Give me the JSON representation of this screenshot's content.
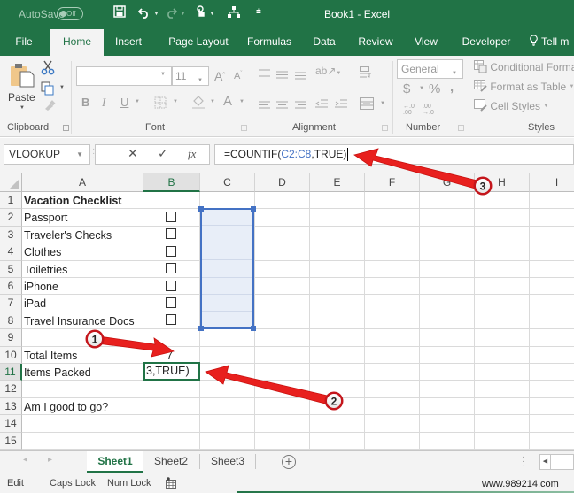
{
  "titlebar": {
    "autosave_label": "AutoSave",
    "autosave_state": "Off",
    "title": "Book1  -  Excel",
    "quick_access": [
      "save-icon",
      "undo-icon",
      "redo-icon",
      "touch-mode-icon",
      "org-chart-icon",
      "customize-qat-icon"
    ]
  },
  "ribbon_tabs": [
    {
      "label": "File",
      "active": false
    },
    {
      "label": "Home",
      "active": true
    },
    {
      "label": "Insert",
      "active": false
    },
    {
      "label": "Page Layout",
      "active": false
    },
    {
      "label": "Formulas",
      "active": false
    },
    {
      "label": "Data",
      "active": false
    },
    {
      "label": "Review",
      "active": false
    },
    {
      "label": "View",
      "active": false
    },
    {
      "label": "Developer",
      "active": false
    },
    {
      "label": "Tell m",
      "active": false
    }
  ],
  "ribbon": {
    "clipboard": {
      "label": "Clipboard",
      "paste_label": "Paste"
    },
    "font": {
      "label": "Font",
      "font_name": "",
      "font_size": "11",
      "bold": "B",
      "italic": "I",
      "underline": "U",
      "font_color": "A"
    },
    "alignment": {
      "label": "Alignment"
    },
    "number": {
      "label": "Number",
      "format": "General",
      "currency": "$",
      "percent": "%",
      "comma": ",",
      "inc_decimal": "←.0\n.00",
      "dec_decimal": ".00\n→.0"
    },
    "styles": {
      "label": "Styles",
      "conditional": "Conditional Forma",
      "format_table": "Format as Table",
      "cell_styles": "Cell Styles"
    }
  },
  "formula_bar": {
    "name_box": "VLOOKUP",
    "cancel": "✕",
    "enter": "✓",
    "fx": "fx",
    "formula_prefix": "=COUNTIF(",
    "formula_ref": "C2:C8",
    "formula_suffix": ",TRUE)"
  },
  "columns": [
    "A",
    "B",
    "C",
    "D",
    "E",
    "F",
    "G",
    "H",
    "I"
  ],
  "selected_column": "B",
  "rows": [
    "1",
    "2",
    "3",
    "4",
    "5",
    "6",
    "7",
    "8",
    "9",
    "10",
    "11",
    "12",
    "13",
    "14",
    "15"
  ],
  "selected_row": "11",
  "cells": {
    "A1": "Vacation Checklist",
    "A2": "Passport",
    "A3": "Traveler's Checks",
    "A4": "Clothes",
    "A5": "Toiletries",
    "A6": "iPhone",
    "A7": "iPad",
    "A8": "Travel Insurance Docs",
    "A10": "Total Items",
    "B10": "7",
    "A11": "Items Packed",
    "B11": "3,TRUE)",
    "A13": "Am I good to go?"
  },
  "checkboxes": [
    {
      "row": 2,
      "checked": false
    },
    {
      "row": 3,
      "checked": false
    },
    {
      "row": 4,
      "checked": false
    },
    {
      "row": 5,
      "checked": false
    },
    {
      "row": 6,
      "checked": false
    },
    {
      "row": 7,
      "checked": false
    },
    {
      "row": 8,
      "checked": false
    }
  ],
  "highlighted_range": "C2:C8",
  "active_cell": "B11",
  "sheets": [
    {
      "label": "Sheet1",
      "active": true
    },
    {
      "label": "Sheet2",
      "active": false
    },
    {
      "label": "Sheet3",
      "active": false
    }
  ],
  "statusbar": {
    "mode": "Edit",
    "caps_lock": "Caps Lock",
    "num_lock": "Num Lock",
    "watermark": "www.989214.com"
  },
  "annotations": [
    {
      "number": "1",
      "target": "B10"
    },
    {
      "number": "2",
      "target": "B11"
    },
    {
      "number": "3",
      "target": "formula-bar"
    }
  ],
  "colors": {
    "excel_green": "#217346",
    "range_blue": "#4472c4",
    "arrow_red": "#e8201e"
  }
}
